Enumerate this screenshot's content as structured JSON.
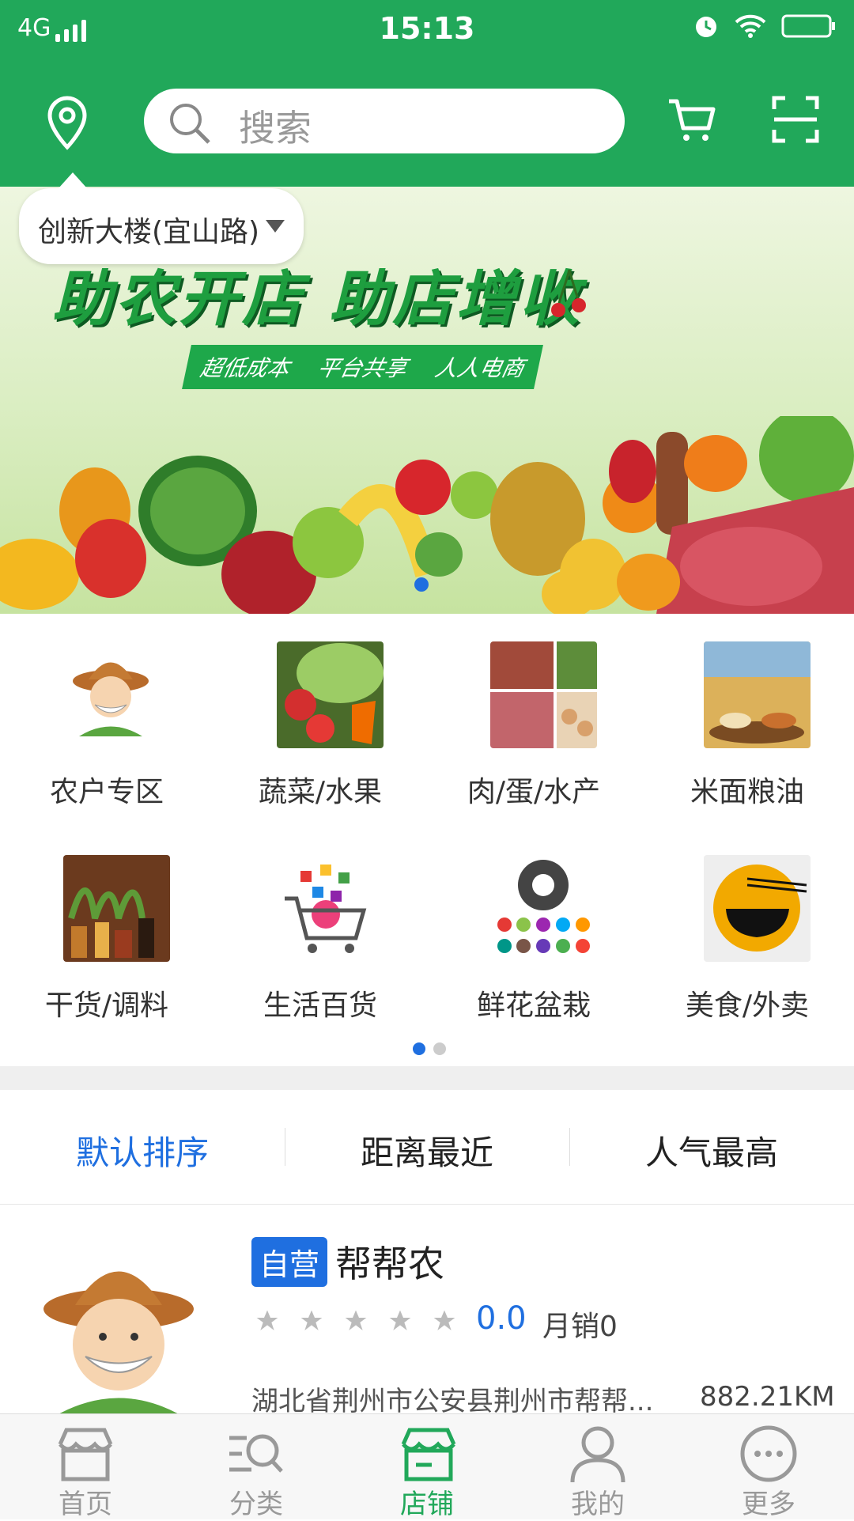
{
  "status": {
    "network": "4G",
    "time": "15:13"
  },
  "header": {
    "search_placeholder": "搜索"
  },
  "location": {
    "name": "创新大楼(宜山路)"
  },
  "banner": {
    "slogan": "助农开店  助店增收",
    "tags": [
      "超低成本",
      "平台共享",
      "人人电商"
    ]
  },
  "categories": [
    {
      "label": "农户专区",
      "icon": "farmer-icon"
    },
    {
      "label": "蔬菜/水果",
      "icon": "vegetables-icon"
    },
    {
      "label": "肉/蛋/水产",
      "icon": "meat-icon"
    },
    {
      "label": "米面粮油",
      "icon": "grain-icon"
    },
    {
      "label": "干货/调料",
      "icon": "spices-icon"
    },
    {
      "label": "生活百货",
      "icon": "shopping-cart-icon"
    },
    {
      "label": "鲜花盆栽",
      "icon": "flower-icon"
    },
    {
      "label": "美食/外卖",
      "icon": "noodle-bowl-icon"
    }
  ],
  "sort": {
    "options": [
      "默认排序",
      "距离最近",
      "人气最高"
    ],
    "active": "默认排序"
  },
  "shop": {
    "badge": "自营",
    "name": "帮帮农",
    "rating": "0.0",
    "stars": 5,
    "sales": "月销0",
    "address": "湖北省荆州市公安县荆州市帮帮...",
    "distance": "882.21KM"
  },
  "tabs": [
    {
      "label": "首页"
    },
    {
      "label": "分类"
    },
    {
      "label": "店铺"
    },
    {
      "label": "我的"
    },
    {
      "label": "更多"
    }
  ],
  "active_tab": "店铺",
  "colors": {
    "brand": "#21a85a",
    "accent": "#1f6fe0"
  }
}
